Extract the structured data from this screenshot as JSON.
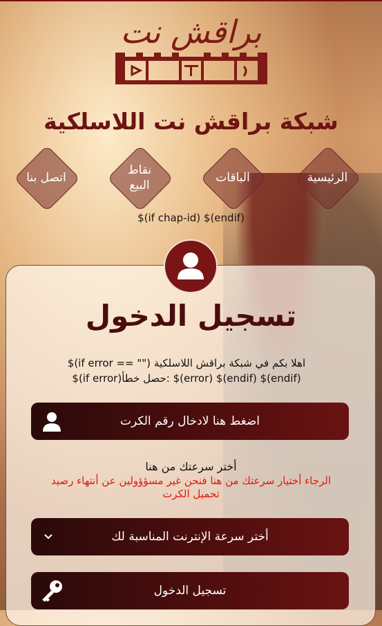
{
  "brand": {
    "logo_text": "براقش نت",
    "network_title": "شبكة براقش نت اللاسلكية"
  },
  "nav": {
    "items": [
      {
        "label": "الرئيسية"
      },
      {
        "label": "الباقات"
      },
      {
        "label": "نقاط البيع"
      },
      {
        "label": "اتصل بنا"
      }
    ]
  },
  "chap_text": "$(if chap-id) $(endif)",
  "login": {
    "title": "تسجيل الدخول",
    "message_line1": "$(if error == \"\") اهلا بكم في شبكة براقش اللاسلكية",
    "message_line2": "$(if error)حصل خطأ: $(error) $(endif) $(endif)",
    "card_button_label": "اضغط هنا لادخال رقم الكرت",
    "speed_heading": "أختر سرعتك من هنا",
    "speed_warning": "الرجاء أختيار سرعتك من هنا فنحن غير مسؤؤولين عن أنتهاء رصيد تحميل الكرت",
    "speed_select_value": "أختر سرعة الإنترنت المناسبة لك",
    "submit_label": "تسجيل الدخول"
  },
  "icons": {
    "user": "user-icon",
    "key": "key-icon",
    "chevron": "chevron-down-icon",
    "fort": "fort-logo-icon"
  },
  "colors": {
    "brand": "#7e1b16",
    "button_dark": "#2a0a0a",
    "button_light": "#6a1212",
    "warning": "#e0190f"
  }
}
